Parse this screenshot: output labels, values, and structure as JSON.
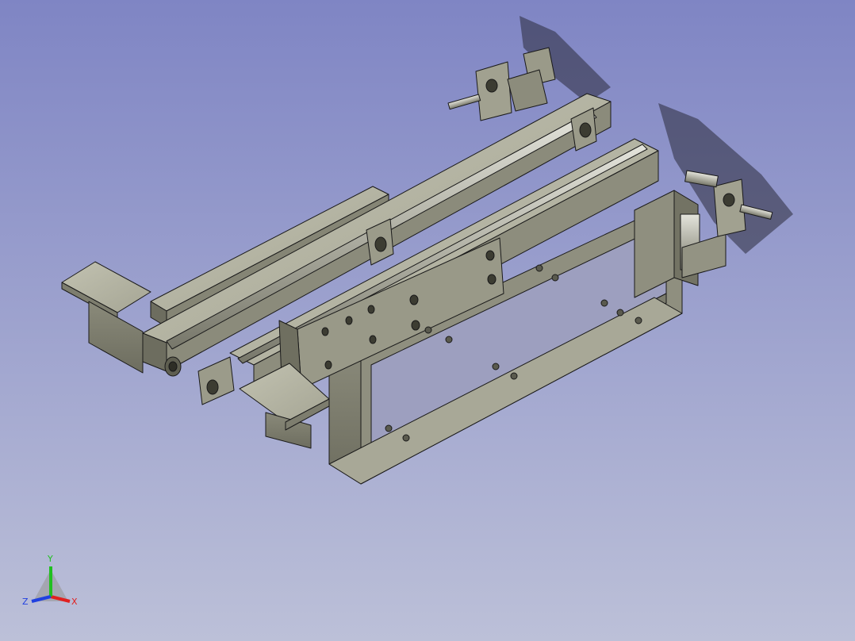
{
  "viewport": {
    "background_top": "#7f85c4",
    "background_bottom": "#bcc0d8"
  },
  "model": {
    "face_color": "#9a9a88",
    "face_light": "#b7b7a6",
    "face_dark": "#6f6f60",
    "edge_color": "#1a1a1a"
  },
  "triad": {
    "x_label": "X",
    "y_label": "Y",
    "z_label": "Z",
    "x_color": "#e02020",
    "y_color": "#20c020",
    "z_color": "#2040e0"
  }
}
